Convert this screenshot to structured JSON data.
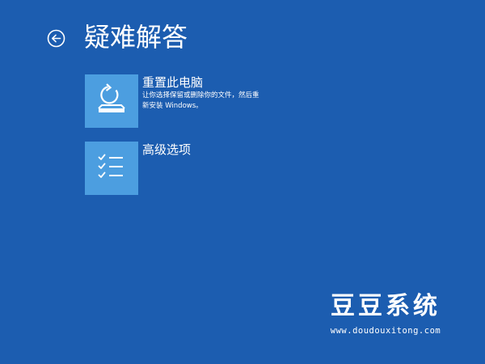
{
  "header": {
    "back_icon": "back-arrow-circle-icon",
    "title": "疑难解答"
  },
  "options": [
    {
      "icon": "reset-pc-icon",
      "title": "重置此电脑",
      "description": "让你选择保留或删除你的文件，然后重新安装 Windows。"
    },
    {
      "icon": "advanced-options-checklist-icon",
      "title": "高级选项",
      "description": ""
    }
  ],
  "watermark": {
    "title": "豆豆系统",
    "url": "www.doudouxitong.com"
  },
  "colors": {
    "background": "#1c5db0",
    "tile": "#4c9ee0",
    "text": "#ffffff"
  }
}
